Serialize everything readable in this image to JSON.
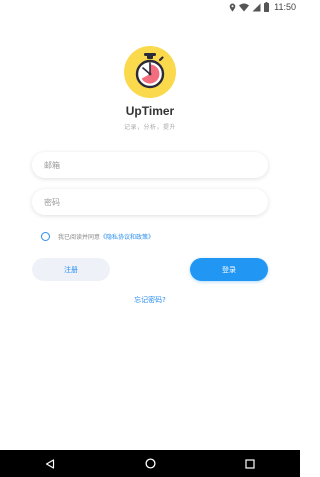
{
  "status_bar": {
    "time": "11:50",
    "icons": [
      "location-icon",
      "wifi-icon",
      "signal-icon",
      "battery-icon"
    ]
  },
  "app": {
    "logo_icon": "stopwatch-icon",
    "name": "UpTimer",
    "tagline": "记录，分析，提升"
  },
  "form": {
    "email_placeholder": "邮箱",
    "password_placeholder": "密码",
    "agree_text": "我已阅读并同意",
    "agree_link": "《隐私协议和政策》",
    "agree_checked": false
  },
  "buttons": {
    "register": "注册",
    "login": "登录"
  },
  "forgot_password": "忘记密码?",
  "nav": {
    "icons": [
      "back-icon",
      "home-icon",
      "recents-icon"
    ]
  },
  "colors": {
    "accent": "#2296f3",
    "logo_bg": "#fbd94c",
    "register_bg": "#eef2f8"
  }
}
